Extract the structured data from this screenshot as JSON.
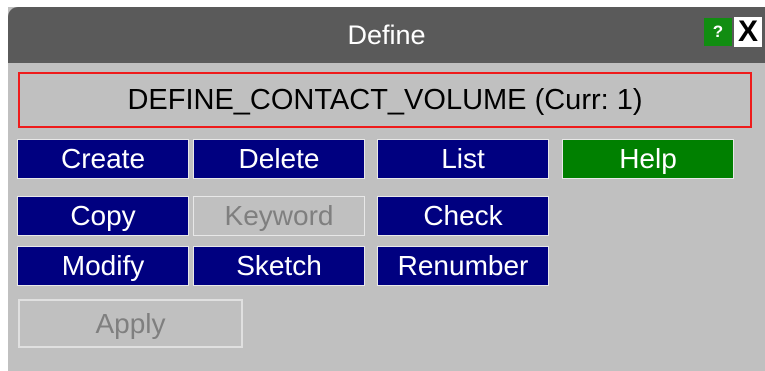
{
  "window": {
    "title": "Define",
    "help_icon": "?",
    "close_icon": "X"
  },
  "current_item": "DEFINE_CONTACT_VOLUME (Curr: 1)",
  "buttons": {
    "create": "Create",
    "delete": "Delete",
    "list": "List",
    "help": "Help",
    "copy": "Copy",
    "keyword": "Keyword",
    "check": "Check",
    "modify": "Modify",
    "sketch": "Sketch",
    "renumber": "Renumber"
  },
  "apply_label": "Apply",
  "colors": {
    "panel_background": "#c0c0c0",
    "title_bar": "#5a5a5a",
    "button_blue": "#000080",
    "help_green": "#008000",
    "current_border_red": "#ee1b1b",
    "disabled_text": "#7f7f7f"
  }
}
